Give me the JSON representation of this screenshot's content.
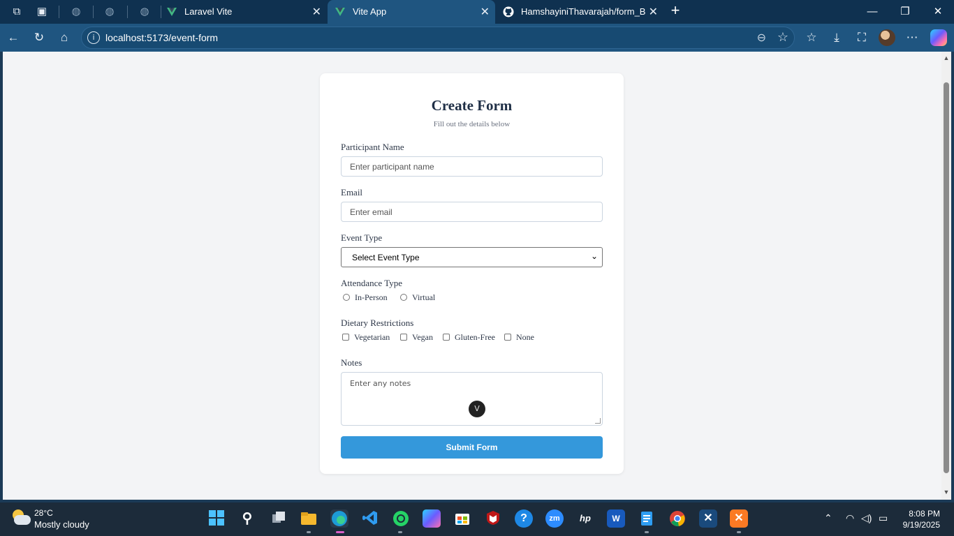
{
  "browser": {
    "tabs": [
      {
        "label": "Laravel Vite",
        "favicon": "vue-logo-icon",
        "active": false
      },
      {
        "label": "Vite App",
        "favicon": "vue-logo-icon",
        "active": true
      },
      {
        "label": "HamshayiniThavarajah/form_Buil",
        "favicon": "github-icon",
        "active": false
      }
    ],
    "address": {
      "url": "localhost:5173/event-form"
    },
    "accent": "#1f5580"
  },
  "form": {
    "title": "Create Form",
    "subtitle": "Fill out the details below",
    "participant_label": "Participant Name",
    "participant_placeholder": "Enter participant name",
    "email_label": "Email",
    "email_placeholder": "Enter email",
    "event_type_label": "Event Type",
    "event_type_selected": "Select Event Type",
    "attendance_label": "Attendance Type",
    "attendance_options": [
      "In-Person",
      "Virtual"
    ],
    "dietary_label": "Dietary Restrictions",
    "dietary_options": [
      "Vegetarian",
      "Vegan",
      "Gluten-Free",
      "None"
    ],
    "notes_label": "Notes",
    "notes_placeholder": "Enter any notes",
    "submit_label": "Submit Form",
    "button_color": "#3498db"
  },
  "taskbar": {
    "weather_temp": "28°C",
    "weather_desc": "Mostly cloudy",
    "time": "8:08 PM",
    "date": "9/19/2025",
    "apps": [
      "start-icon",
      "search-icon",
      "task-view-icon",
      "file-explorer-icon",
      "edge-icon",
      "vscode-icon",
      "whatsapp-icon",
      "copilot-icon",
      "store-icon",
      "mcafee-icon",
      "help-icon",
      "zoom-icon",
      "hp-icon",
      "word-icon",
      "notepad-icon",
      "chrome-icon",
      "xampp-x-icon",
      "xampp-icon"
    ]
  }
}
